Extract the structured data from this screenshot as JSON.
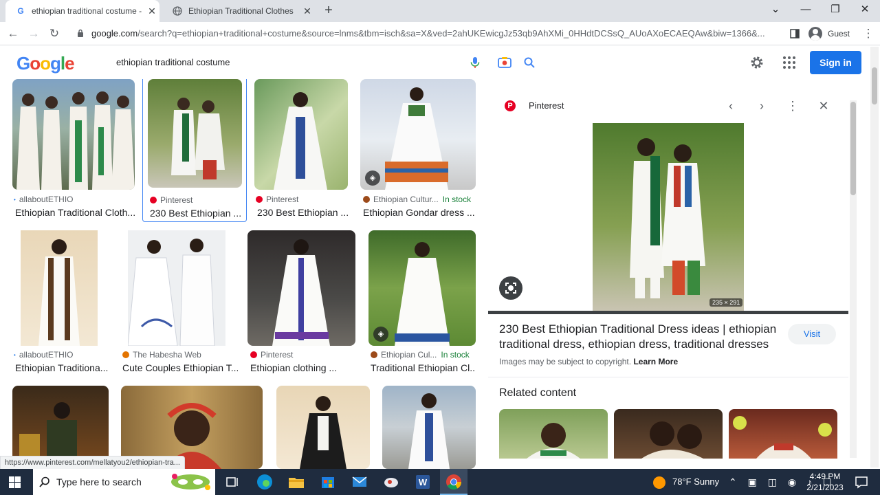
{
  "browser": {
    "tabs": [
      {
        "title": "ethiopian traditional costume - G",
        "active": true,
        "favicon": "google-g-icon"
      },
      {
        "title": "Ethiopian Traditional Clothes",
        "active": false,
        "favicon": "globe-icon"
      }
    ],
    "url_host": "google.com",
    "url_rest": "/search?q=ethiopian+traditional+costume&source=lnms&tbm=isch&sa=X&ved=2ahUKEwicgJz53qb9AhXMi_0HHdtDCSsQ_AUoAXoECAEQAw&biw=1366&...",
    "profile_label": "Guest"
  },
  "google": {
    "logo_letters": [
      "G",
      "o",
      "o",
      "g",
      "l",
      "e"
    ],
    "logo_colors": [
      "#4285f4",
      "#ea4335",
      "#fbbc05",
      "#4285f4",
      "#34a853",
      "#ea4335"
    ],
    "query": "ethiopian traditional costume",
    "sign_in": "Sign in"
  },
  "results": [
    {
      "source": "allaboutETHIO",
      "caption": "Ethiopian Traditional Cloth...",
      "stock": ""
    },
    {
      "source": "Pinterest",
      "caption": "230 Best Ethiopian ...",
      "stock": ""
    },
    {
      "source": "Pinterest",
      "caption": "230 Best Ethiopian ...",
      "stock": ""
    },
    {
      "source": "Ethiopian Cultur...",
      "caption": "Ethiopian Gondar dress ...",
      "stock": "In stock"
    },
    {
      "source": "allaboutETHIO",
      "caption": "Ethiopian Traditiona...",
      "stock": ""
    },
    {
      "source": "The Habesha Web",
      "caption": "Cute Couples Ethiopian T...",
      "stock": ""
    },
    {
      "source": "Pinterest",
      "caption": "Ethiopian clothing ...",
      "stock": ""
    },
    {
      "source": "Ethiopian Cul...",
      "caption": "Traditional Ethiopian Cl...",
      "stock": "In stock"
    }
  ],
  "panel": {
    "source": "Pinterest",
    "image_size": "235 × 291",
    "title": "230 Best Ethiopian Traditional Dress ideas | ethiopian traditional dress, ethiopian dress, traditional dresses",
    "visit": "Visit",
    "copyright": "Images may be subject to copyright.",
    "learn_more": "Learn More",
    "related": "Related content"
  },
  "status_url": "https://www.pinterest.com/mellatyou2/ethiopian-tra...",
  "taskbar": {
    "search_placeholder": "Type here to search",
    "weather": "78°F  Sunny",
    "time": "4:49 PM",
    "date": "2/21/2023"
  },
  "colors": {
    "accent": "#1a73e8",
    "pinterest": "#e60023",
    "in_stock": "#188038"
  }
}
